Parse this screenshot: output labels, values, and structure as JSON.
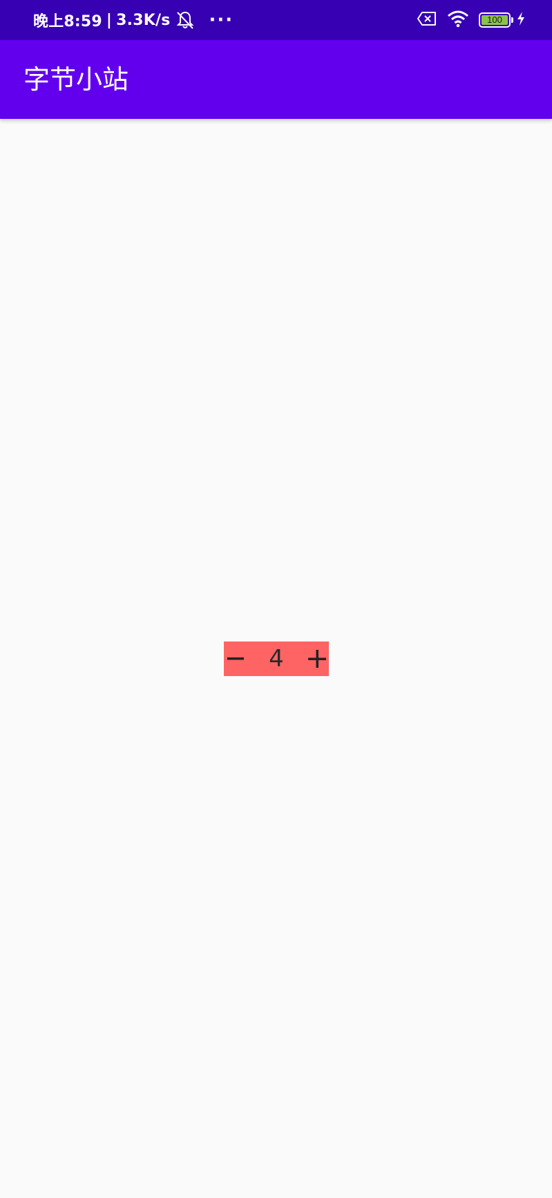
{
  "status_bar": {
    "time": "晚上8:59",
    "separator": "|",
    "net_speed": "3.3K/s",
    "more": "···",
    "battery_level": "100",
    "icons": [
      "mute-bell-icon",
      "sim-off-icon",
      "wifi-icon",
      "battery-icon",
      "charging-icon"
    ]
  },
  "app_bar": {
    "title": "字节小站",
    "color": "#6200ee",
    "status_color": "#3700b3"
  },
  "stepper": {
    "minus": "−",
    "value": "4",
    "plus": "+",
    "color": "#ff6464"
  }
}
